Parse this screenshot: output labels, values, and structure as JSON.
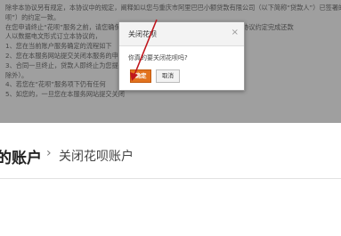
{
  "background_document": {
    "lines": [
      "除非本协议另有规定，本协议中的规定，阐释如以您与重庆市阿里巴巴小额贷款有限公司（以下简称“贷款人”）已签署的《花",
      "呗”）的约定一致。",
      "在您申请终止“花呗”服务之前，请您确保您没有未清偿的花呗欠款，且您已经按照本协议约定完成还款",
      "人以数据电文形式订立本协议的，",
      "1、您在当前账户服务确定的流程如下",
      "2、您在本服务网站提交关闭本服务的申请",
      "3、合同一旦终止，贷款人即终止为您提供",
      "除外）。",
      "4、若您在“花呗”服务项下仍有任何",
      "5、如您的，一旦您在本服务网站提交关闭"
    ]
  },
  "account_bar": {
    "title": "的账户",
    "separator": "›",
    "current": "关闭花呗账户"
  },
  "dialog": {
    "title": "关闭花呗",
    "close_symbol": "×",
    "message": "你真的要关闭花呗吗?",
    "ok_label": "确定",
    "cancel_label": "取消"
  },
  "colors": {
    "overlay": "#373737",
    "primary_button": "#e2731e",
    "annotation_arrow": "#c0161d"
  }
}
